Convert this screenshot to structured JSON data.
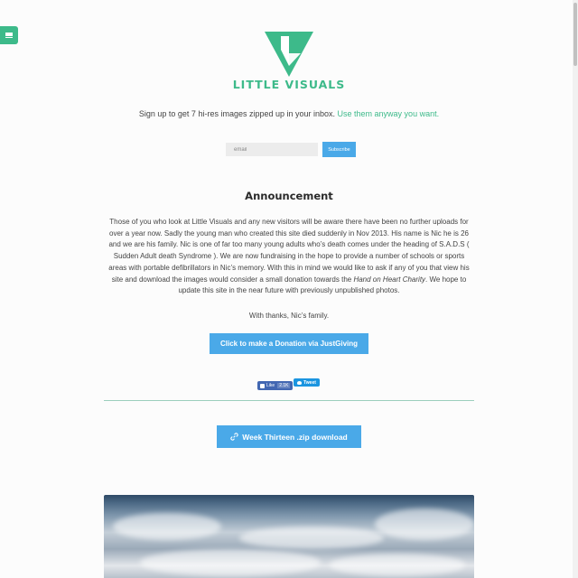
{
  "site": {
    "brand": "LITTLE VISUALS",
    "accent_color": "#3dba8a",
    "button_color": "#4aa9e8"
  },
  "signup": {
    "text": "Sign up to get 7 hi-res images zipped up in your inbox. ",
    "link": "Use them anyway you want.",
    "email_placeholder": "email",
    "subscribe_label": "Subscribe"
  },
  "announcement": {
    "title": "Announcement",
    "body_1": "Those of you who look at Little Visuals and any new visitors will be aware there have been no further uploads for over a year now. Sadly the young man who created this site died suddenly in Nov 2013. His name is Nic he is 26 and we are his family. Nic is one of far too many young adults who’s death comes under the heading of S.A.D.S ( Sudden Adult death Syndrome ). We are now fundraising in the hope to provide a number of schools or sports areas with portable defibrillators in Nic’s memory. With this in mind we would like to ask if any of you that view his site and download the images would consider a small donation towards the ",
    "body_em": "Hand on Heart Charity",
    "body_2": ". We hope to update this site in the near future with previously unpublished photos.",
    "thanks": "With thanks, Nic’s family.",
    "donate_label": "Click to make a Donation via JustGiving"
  },
  "social": {
    "like_label": "Like",
    "like_count": "2.1K",
    "tweet_label": "Tweet"
  },
  "download": {
    "label": "Week Thirteen .zip download"
  },
  "icons": [
    "menu-icon",
    "logo-icon",
    "facebook-like-icon",
    "twitter-bird-icon",
    "link-icon"
  ]
}
